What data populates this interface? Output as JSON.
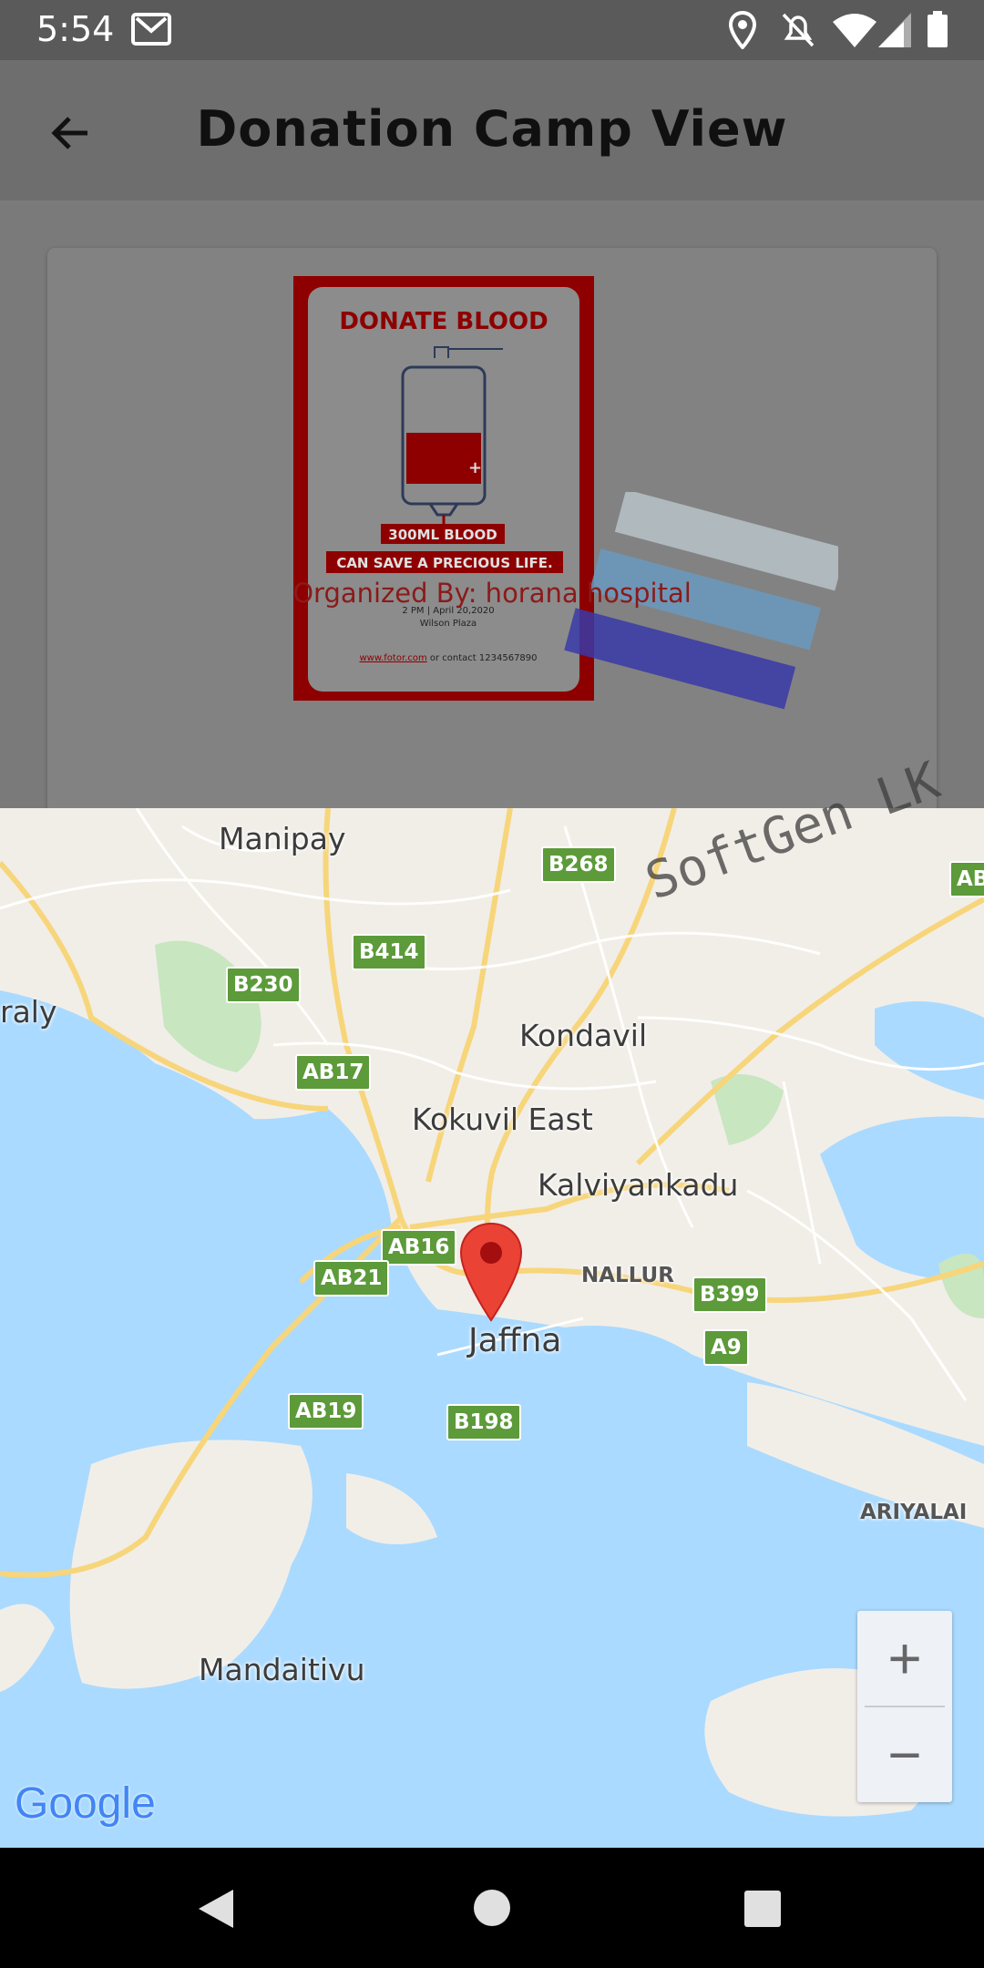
{
  "status_bar": {
    "time": "5:54"
  },
  "app_bar": {
    "title": "Donation Camp View"
  },
  "camp": {
    "poster": {
      "headline": "DONATE BLOOD",
      "line1": "300ML BLOOD",
      "line2": "CAN SAVE A PRECIOUS LIFE.",
      "event": "2 PM  |  April 20,2020",
      "venue": "Wilson Plaza",
      "contact_link": "www.fotor.com",
      "contact_rest": " or contact 1234567890"
    },
    "organized_by": "Organized By: horana hospital"
  },
  "watermark": "SoftGen LK",
  "map": {
    "places": [
      "Manipay",
      "Kondavil",
      "Kokuvil East",
      "Kalviyankadu",
      "Jaffna",
      "Mandaitivu",
      "NALLUR",
      "ARIYALAI",
      "raly"
    ],
    "road_shields": [
      "B268",
      "B414",
      "B230",
      "AB17",
      "AB16",
      "AB21",
      "AB19",
      "B198",
      "B399",
      "A9",
      "AB"
    ],
    "zoom_in": "+",
    "zoom_out": "−",
    "attribution": "Google"
  },
  "colors": {
    "status_bar": "#5a5a5a",
    "app_bar": "#6e6e6e",
    "water": "#aadaff",
    "land": "#f1eee8",
    "road_shield": "#5c9a3a",
    "marker": "#ea4335"
  }
}
